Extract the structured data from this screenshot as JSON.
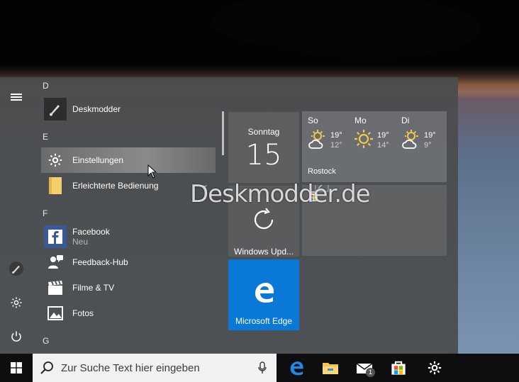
{
  "colors": {
    "accent": "#0a78d7",
    "taskbar": "#0e0e10",
    "start_bg": "#4a4c4e"
  },
  "start_menu": {
    "rail": [
      {
        "name": "menu-icon",
        "label": ""
      },
      {
        "name": "user-icon",
        "label": ""
      },
      {
        "name": "gear-icon",
        "label": ""
      },
      {
        "name": "power-icon",
        "label": ""
      }
    ],
    "letters": {
      "d": "D",
      "e": "E",
      "f": "F",
      "g": "G"
    },
    "apps": {
      "deskmodder": "Deskmodder",
      "einstellungen": "Einstellungen",
      "erleichterte": "Erleichterte Bedienung",
      "facebook": "Facebook",
      "facebook_sub": "Neu",
      "feedback": "Feedback-Hub",
      "filme": "Filme & TV",
      "fotos": "Fotos"
    },
    "expand_glyph": "⌄"
  },
  "tiles": {
    "calendar": {
      "day": "Sonntag",
      "date": "15"
    },
    "weather": {
      "city": "Rostock",
      "days": [
        {
          "day": "So",
          "hi": "19°",
          "lo": "12°",
          "icon": "partly-cloudy-icon"
        },
        {
          "day": "Mo",
          "hi": "19°",
          "lo": "14°",
          "icon": "sun-icon"
        },
        {
          "day": "Di",
          "hi": "19°",
          "lo": "9°",
          "icon": "partly-cloudy-icon"
        }
      ]
    },
    "update": {
      "label": "Windows Upd..."
    },
    "edge": {
      "label": "Microsoft Edge"
    }
  },
  "watermark": "Deskmodder.de",
  "taskbar": {
    "search_placeholder": "Zur Suche Text hier eingeben",
    "mail_badge": "1"
  }
}
